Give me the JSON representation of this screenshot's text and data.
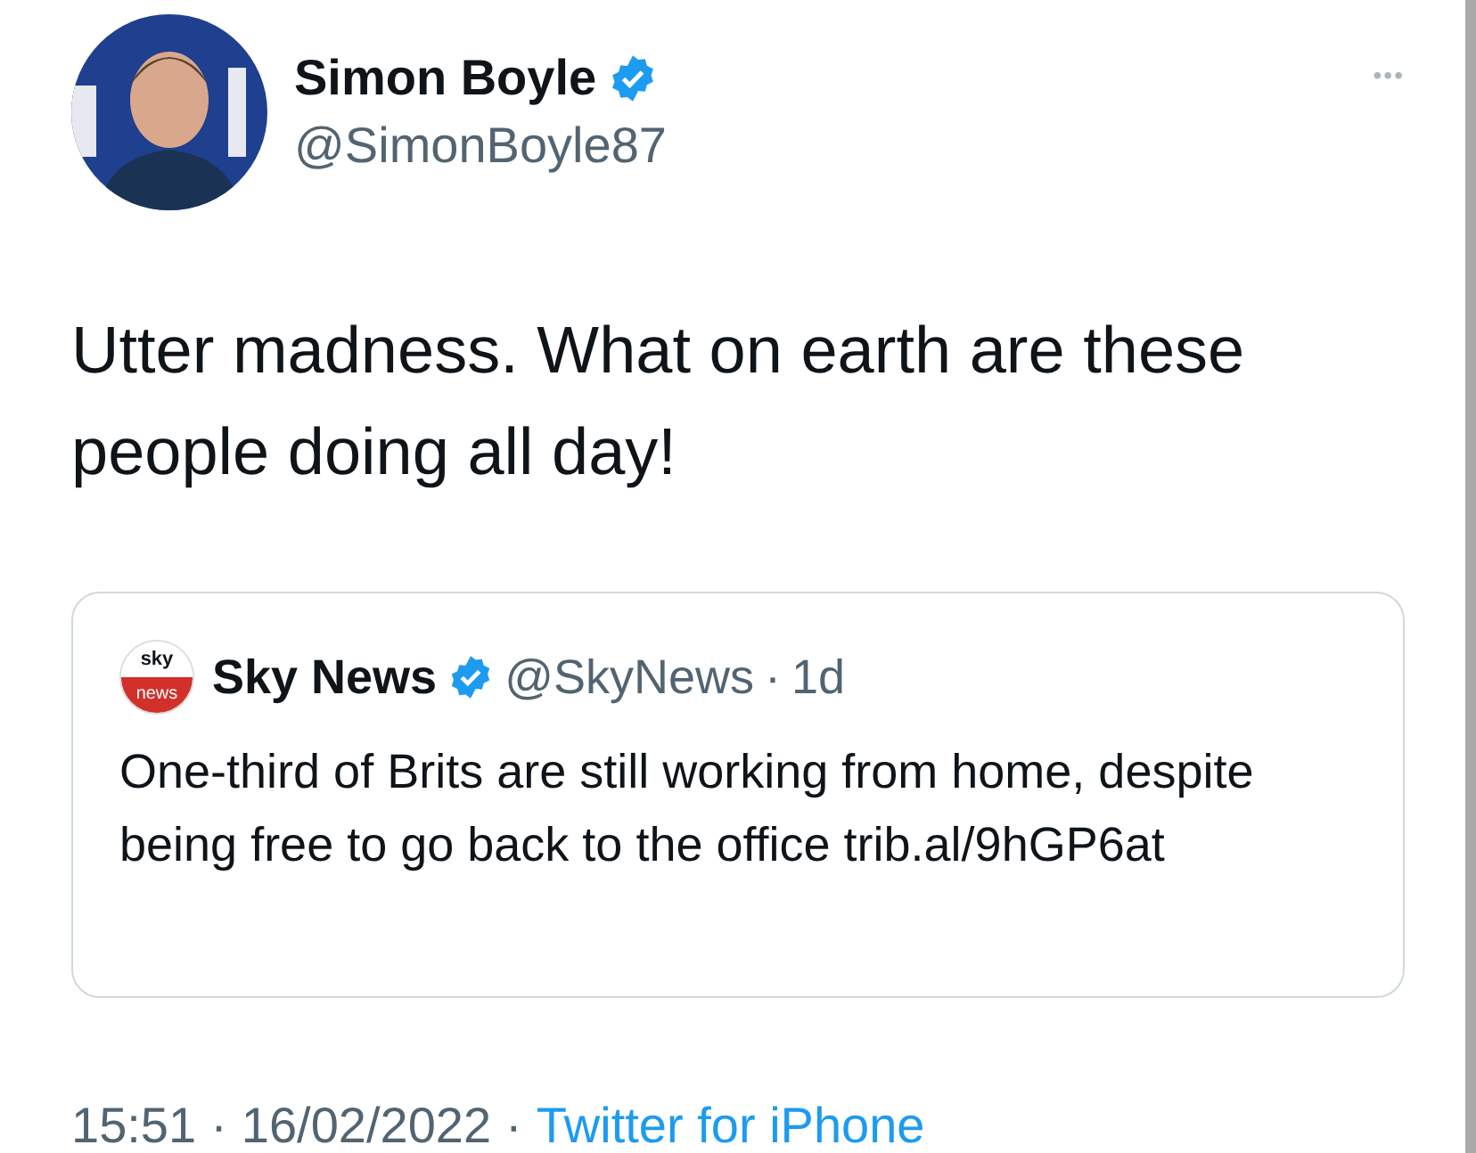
{
  "author": {
    "name": "Simon Boyle",
    "handle": "@SimonBoyle87",
    "verified": true
  },
  "menu": {
    "label": "•••"
  },
  "text": "Utter madness. What on earth are these people doing all day!",
  "quote": {
    "logo_top": "sky",
    "logo_bottom": "news",
    "name": "Sky News",
    "verified": true,
    "handle": "@SkyNews",
    "separator": "·",
    "age": "1d",
    "text": "One-third of Brits are still working from home, despite being free to go back to the office trib.al/9hGP6at"
  },
  "footer": {
    "time": "15:51",
    "separator_1": "·",
    "date": "16/02/2022",
    "separator_2": "·",
    "source": "Twitter for iPhone"
  }
}
